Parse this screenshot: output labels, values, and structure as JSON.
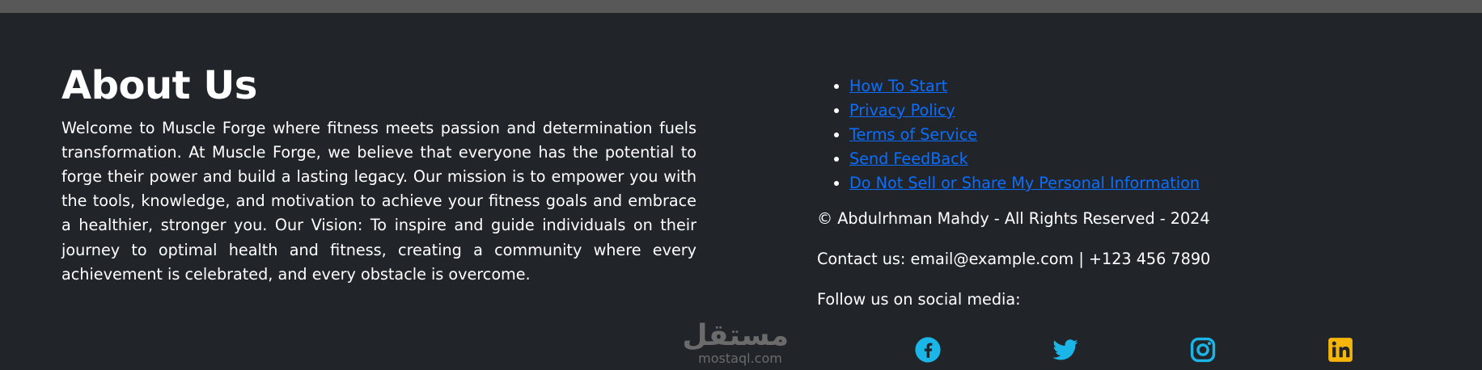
{
  "about": {
    "title": "About Us",
    "body": "Welcome to Muscle Forge where fitness meets passion and determination fuels transformation. At Muscle Forge, we believe that everyone has the potential to forge their power and build a lasting legacy. Our mission is to empower you with the tools, knowledge, and motivation to achieve your fitness goals and embrace a healthier, stronger you. Our Vision: To inspire and guide individuals on their journey to optimal health and fitness, creating a community where every achievement is celebrated, and every obstacle is overcome."
  },
  "links": [
    {
      "label": "How To Start"
    },
    {
      "label": "Privacy Policy"
    },
    {
      "label": "Terms of Service"
    },
    {
      "label": "Send FeedBack"
    },
    {
      "label": "Do Not Sell or Share My Personal Information"
    }
  ],
  "info": {
    "copyright": "© Abdulrhman Mahdy - All Rights Reserved - 2024",
    "contact": "Contact us: email@example.com | +123 456 7890",
    "follow": "Follow us on social media:"
  },
  "social": [
    {
      "icon": "facebook-icon",
      "color": "#1bb6e8"
    },
    {
      "icon": "twitter-icon",
      "color": "#1bb6e8"
    },
    {
      "icon": "instagram-icon",
      "color": "#1bb6e8"
    },
    {
      "icon": "linkedin-icon",
      "color": "#f5b50a"
    }
  ],
  "watermark": {
    "arabic": "مستقل",
    "latin": "mostaql.com"
  },
  "colors": {
    "background": "#212529",
    "topbar": "#585858",
    "link": "#0d6efd"
  }
}
